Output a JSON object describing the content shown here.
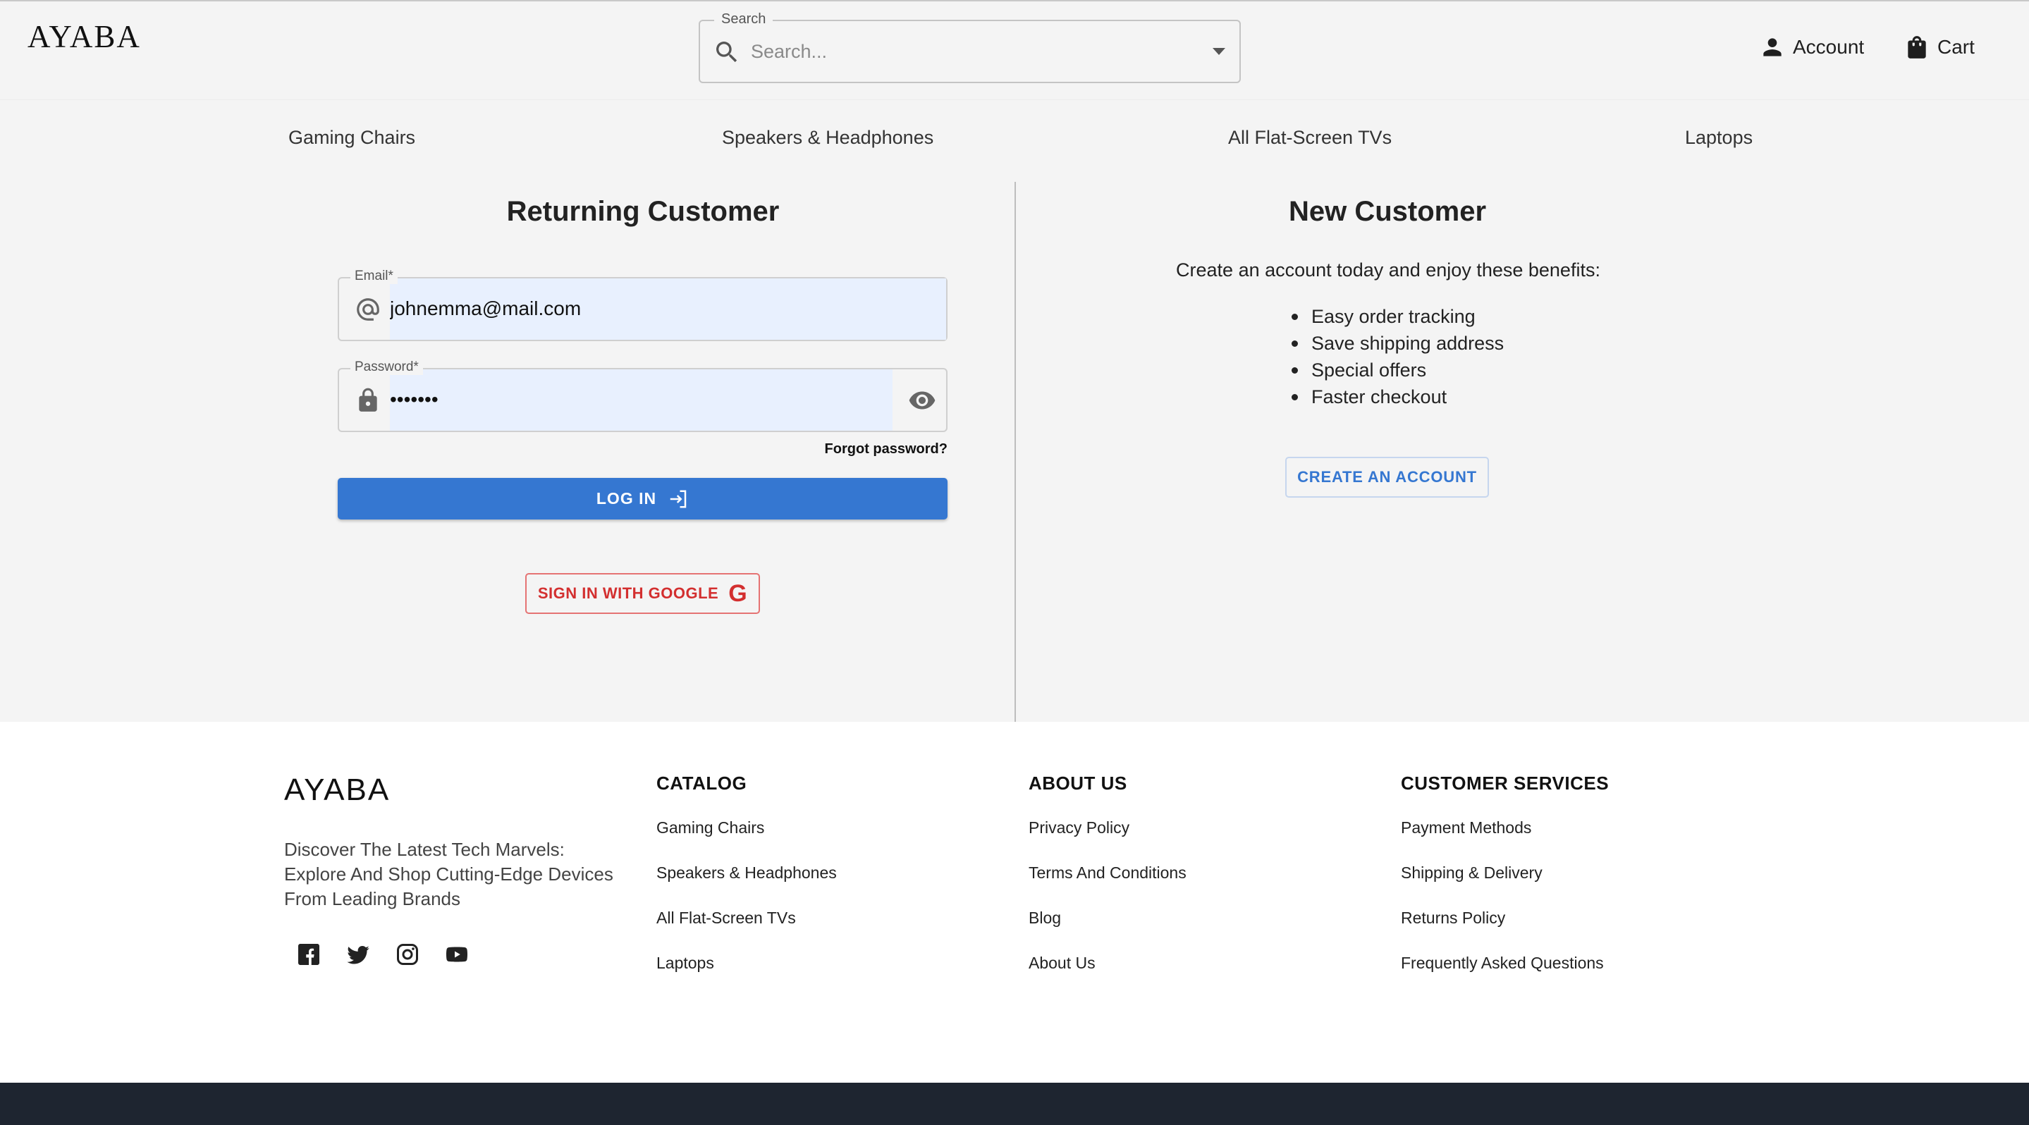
{
  "header": {
    "logo": "AYABA",
    "search": {
      "label": "Search",
      "placeholder": "Search..."
    },
    "account_label": "Account",
    "cart_label": "Cart"
  },
  "nav": {
    "categories": [
      "Gaming Chairs",
      "Speakers & Headphones",
      "All Flat-Screen TVs",
      "Laptops"
    ]
  },
  "returning": {
    "title": "Returning Customer",
    "email_label": "Email",
    "email_value": "johnemma@mail.com",
    "password_label": "Password",
    "password_value": "•••••••",
    "required_mark": "*",
    "forgot": "Forgot password?",
    "login_label": "LOG IN",
    "google_label": "SIGN IN WITH GOOGLE",
    "google_glyph": "G"
  },
  "new_customer": {
    "title": "New Customer",
    "intro": "Create an account today and enjoy these benefits:",
    "benefits": [
      "Easy order tracking",
      "Save shipping address",
      "Special offers",
      "Faster checkout"
    ],
    "create_label": "CREATE AN ACCOUNT"
  },
  "footer": {
    "logo": "AYABA",
    "tagline": "Discover The Latest Tech Marvels: Explore And Shop Cutting-Edge Devices From Leading Brands",
    "social_icons": [
      "facebook-icon",
      "twitter-icon",
      "instagram-icon",
      "youtube-icon"
    ],
    "catalog": {
      "title": "CATALOG",
      "links": [
        "Gaming Chairs",
        "Speakers & Headphones",
        "All Flat-Screen TVs",
        "Laptops"
      ]
    },
    "about": {
      "title": "ABOUT US",
      "links": [
        "Privacy Policy",
        "Terms And Conditions",
        "Blog",
        "About Us"
      ]
    },
    "services": {
      "title": "CUSTOMER SERVICES",
      "links": [
        "Payment Methods",
        "Shipping & Delivery",
        "Returns Policy",
        "Frequently Asked Questions"
      ]
    }
  },
  "colors": {
    "primary": "#3577d1",
    "google_red": "#d32f2f",
    "autofill_bg": "#e8f0fe",
    "page_bg": "#f4f4f4",
    "bottom_bar": "#1e2530"
  }
}
